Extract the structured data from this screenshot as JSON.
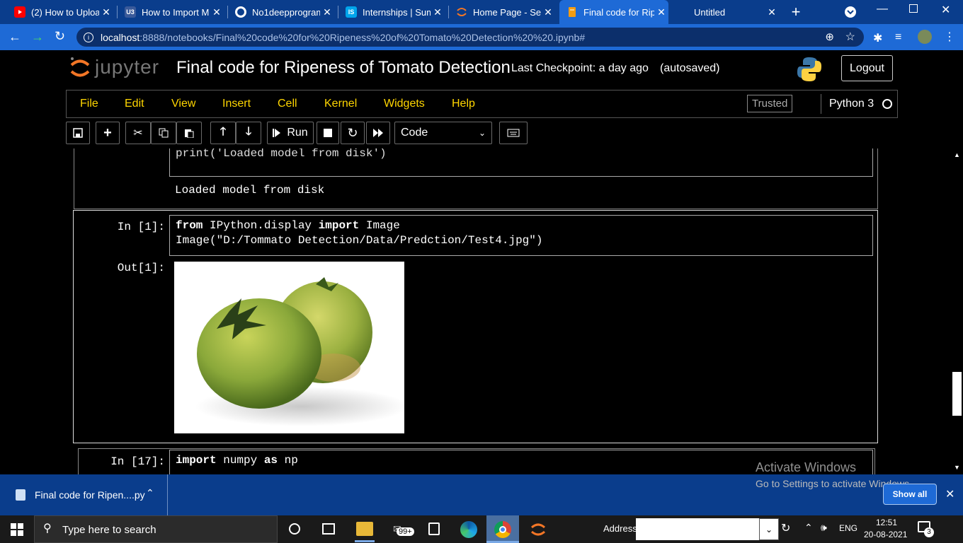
{
  "browser": {
    "tabs": [
      {
        "title": "(2) How to Uploa",
        "icon": "youtube-icon"
      },
      {
        "title": "How to Import M",
        "icon": "site-icon"
      },
      {
        "title": "No1deepprogram",
        "icon": "github-icon"
      },
      {
        "title": "Internships | Sum",
        "icon": "internshala-icon"
      },
      {
        "title": "Home Page - Sele",
        "icon": "jupyter-icon"
      },
      {
        "title": "Final code for Rip",
        "icon": "notebook-icon"
      },
      {
        "title": "Untitled",
        "icon": ""
      }
    ],
    "url_host": "localhost",
    "url_rest": ":8888/notebooks/Final%20code%20for%20Ripeness%20of%20Tomato%20Detection%20%20.ipynb#"
  },
  "jupyter": {
    "logo_text": "jupyter",
    "notebook_title": "Final code for Ripeness of Tomato Detection",
    "checkpoint": "Last Checkpoint: a day ago",
    "autosave": "(autosaved)",
    "logout": "Logout",
    "menu": [
      "File",
      "Edit",
      "View",
      "Insert",
      "Cell",
      "Kernel",
      "Widgets",
      "Help"
    ],
    "trusted": "Trusted",
    "kernel": "Python 3",
    "run_label": "Run",
    "cell_type": "Code"
  },
  "cells": {
    "prev_code_partial": "print('Loaded model from disk')",
    "prev_output": "Loaded model from disk",
    "cell1": {
      "in_prompt": "In [1]:",
      "out_prompt": "Out[1]:",
      "line1_kw1": "from",
      "line1_mod": " IPython.display ",
      "line1_kw2": "import",
      "line1_name": " Image",
      "line2": "Image(\"D:/Tommato Detection/Data/Predction/Test4.jpg\")"
    },
    "cell17": {
      "in_prompt": "In [17]:",
      "kw1": "import",
      "mid": " numpy ",
      "kw2": "as",
      "tail": " np"
    }
  },
  "windows": {
    "activate_title": "Activate Windows",
    "activate_sub": "Go to Settings to activate Windows.",
    "download_name": "Final code for Ripen....py",
    "show_all": "Show all",
    "search_placeholder": "Type here to search",
    "badge": "99+",
    "address_label": "Address",
    "lang": "ENG",
    "time": "12:51",
    "date": "20-08-2021",
    "notif_count": "3"
  }
}
